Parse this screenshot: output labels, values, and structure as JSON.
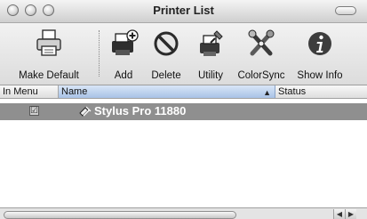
{
  "window": {
    "title": "Printer List"
  },
  "toolbar": {
    "items": [
      {
        "label": "Make Default",
        "icon": "printer-default-icon"
      },
      {
        "label": "Add",
        "icon": "add-printer-icon"
      },
      {
        "label": "Delete",
        "icon": "delete-icon"
      },
      {
        "label": "Utility",
        "icon": "utility-icon"
      },
      {
        "label": "ColorSync",
        "icon": "colorsync-icon"
      },
      {
        "label": "Show Info",
        "icon": "info-icon"
      }
    ]
  },
  "table": {
    "columns": [
      "In Menu",
      "Name",
      "Status"
    ],
    "rows": [
      {
        "in_menu": "☑",
        "name": "Stylus Pro 11880",
        "status": ""
      }
    ]
  }
}
